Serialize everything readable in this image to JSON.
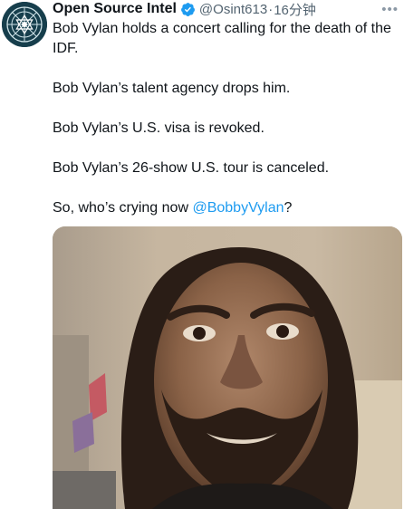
{
  "author": {
    "display_name": "Open Source Intel",
    "handle": "@Osint613",
    "separator": "·",
    "time": "16分钟",
    "verified_icon": "verified-badge-icon",
    "more_icon": "more-horizontal-icon"
  },
  "tweet": {
    "lines": [
      "Bob Vylan holds a concert calling for the death of the IDF.",
      "Bob Vylan’s talent agency drops him.",
      "Bob Vylan’s U.S. visa is revoked.",
      "Bob Vylan’s 26-show U.S. tour is canceled."
    ],
    "closing_prefix": "So, who’s crying now ",
    "mention": "@BobbyVylan",
    "closing_suffix": "?"
  },
  "colors": {
    "mention": "#1d9bf0",
    "verified": "#1d9bf0",
    "secondary_text": "#536471",
    "avatar_bg": "#163e4c"
  }
}
